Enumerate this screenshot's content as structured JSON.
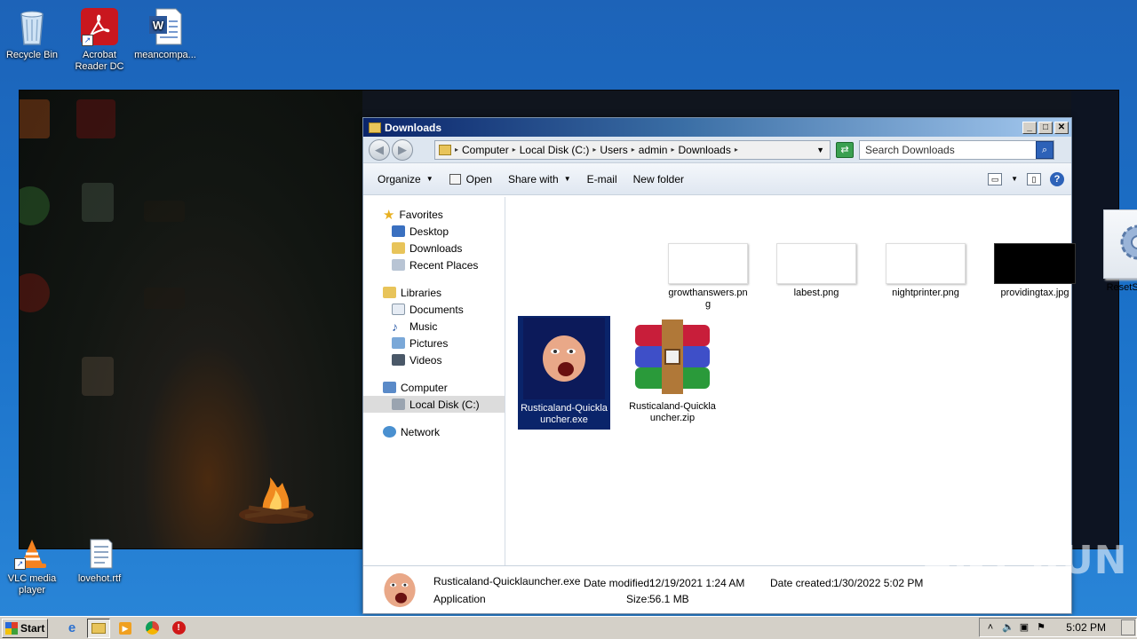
{
  "desktop": {
    "icons": [
      {
        "label": "Recycle Bin"
      },
      {
        "label": "Acrobat Reader DC"
      },
      {
        "label": "meancompa..."
      },
      {
        "label": "VLC media player"
      },
      {
        "label": "lovehot.rtf"
      }
    ]
  },
  "window": {
    "title": "Downloads",
    "breadcrumb": [
      "Computer",
      "Local Disk (C:)",
      "Users",
      "admin",
      "Downloads"
    ],
    "search_placeholder": "Search Downloads",
    "toolbar": {
      "organize": "Organize",
      "open": "Open",
      "share_with": "Share with",
      "email": "E-mail",
      "new_folder": "New folder"
    },
    "nav": {
      "favorites": "Favorites",
      "favorites_items": [
        "Desktop",
        "Downloads",
        "Recent Places"
      ],
      "libraries": "Libraries",
      "libraries_items": [
        "Documents",
        "Music",
        "Pictures",
        "Videos"
      ],
      "computer": "Computer",
      "computer_items": [
        "Local Disk (C:)"
      ],
      "network": "Network"
    },
    "files": [
      {
        "name": "growthanswers.png",
        "line1": "growthanswers.pn",
        "line2": "g"
      },
      {
        "name": "labest.png",
        "line1": "labest.png",
        "line2": ""
      },
      {
        "name": "nightprinter.png",
        "line1": "nightprinter.png",
        "line2": ""
      },
      {
        "name": "providingtax.jpg",
        "line1": "providingtax.jpg",
        "line2": ""
      },
      {
        "name": "ResetSettings.bat",
        "line1": "ResetSettings.bat",
        "line2": ""
      },
      {
        "name": "Rusticaland-Quicklauncher.exe",
        "line1": "Rusticaland-Quickla",
        "line2": "uncher.exe"
      },
      {
        "name": "Rusticaland-Quicklauncher.zip",
        "line1": "Rusticaland-Quickla",
        "line2": "uncher.zip"
      }
    ],
    "details": {
      "filename": "Rusticaland-Quicklauncher.exe",
      "type": "Application",
      "modified_label": "Date modified:",
      "modified_value": "12/19/2021 1:24 AM",
      "size_label": "Size:",
      "size_value": "56.1 MB",
      "created_label": "Date created:",
      "created_value": "1/30/2022 5:02 PM"
    }
  },
  "taskbar": {
    "start": "Start",
    "clock": "5:02 PM"
  },
  "watermark": "ANY RUN"
}
